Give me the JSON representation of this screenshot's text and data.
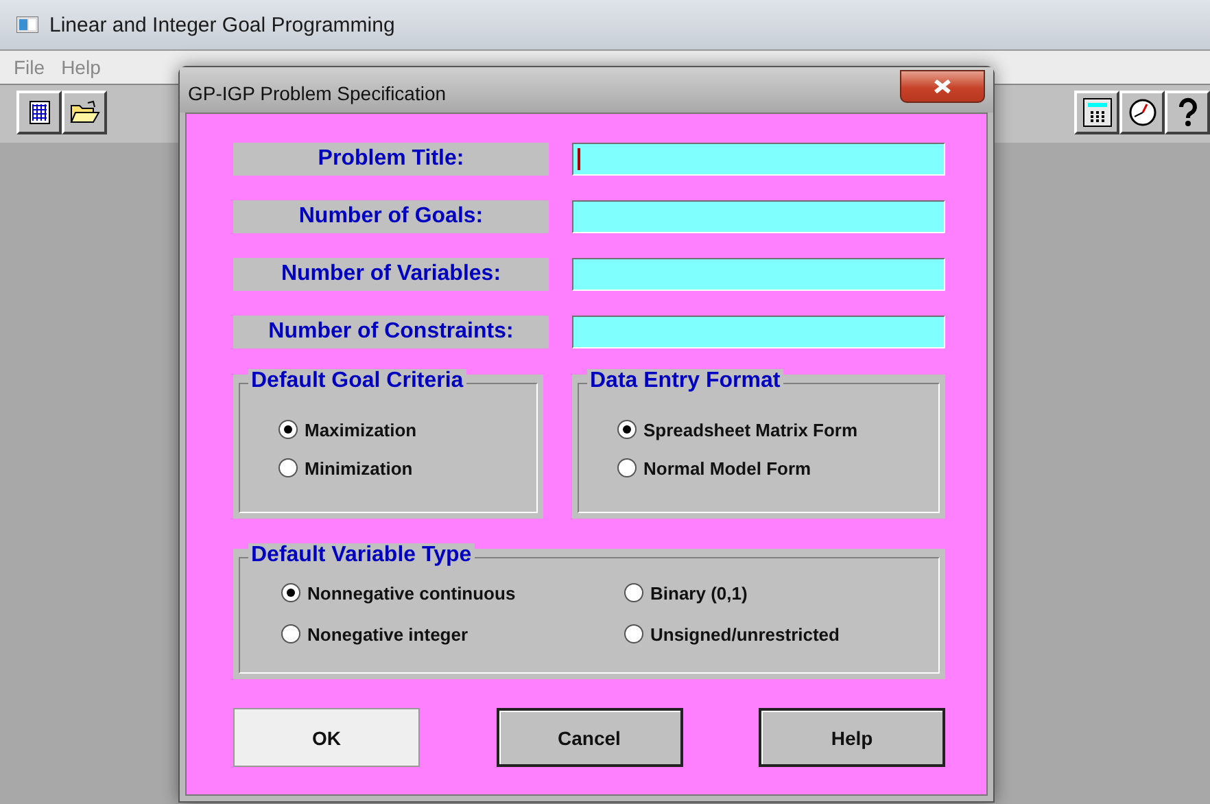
{
  "window": {
    "title": "Linear and Integer Goal Programming"
  },
  "menu": [
    "File",
    "Help"
  ],
  "dialog": {
    "title": "GP-IGP Problem Specification",
    "fields": [
      {
        "label": "Problem Title:",
        "focused": true
      },
      {
        "label": "Number of Goals:",
        "focused": false
      },
      {
        "label": "Number of Variables:",
        "focused": false
      },
      {
        "label": "Number of Constraints:",
        "focused": false
      }
    ],
    "groups": [
      {
        "title": "Default Goal Criteria",
        "kind": "single",
        "options": [
          {
            "label": "Maximization",
            "selected": true
          },
          {
            "label": "Minimization",
            "selected": false
          }
        ]
      },
      {
        "title": "Data Entry Format",
        "kind": "single",
        "options": [
          {
            "label": "Spreadsheet Matrix Form",
            "selected": true
          },
          {
            "label": "Normal Model Form",
            "selected": false
          }
        ]
      },
      {
        "title": "Default Variable Type",
        "kind": "double",
        "options": [
          {
            "label": "Nonnegative continuous",
            "selected": true
          },
          {
            "label": "Binary (0,1)",
            "selected": false
          },
          {
            "label": "Nonegative integer",
            "selected": false
          },
          {
            "label": "Unsigned/unrestricted",
            "selected": false
          }
        ]
      }
    ],
    "buttons": [
      {
        "label": "OK",
        "default": true
      },
      {
        "label": "Cancel",
        "default": false
      },
      {
        "label": "Help",
        "default": false
      }
    ]
  }
}
